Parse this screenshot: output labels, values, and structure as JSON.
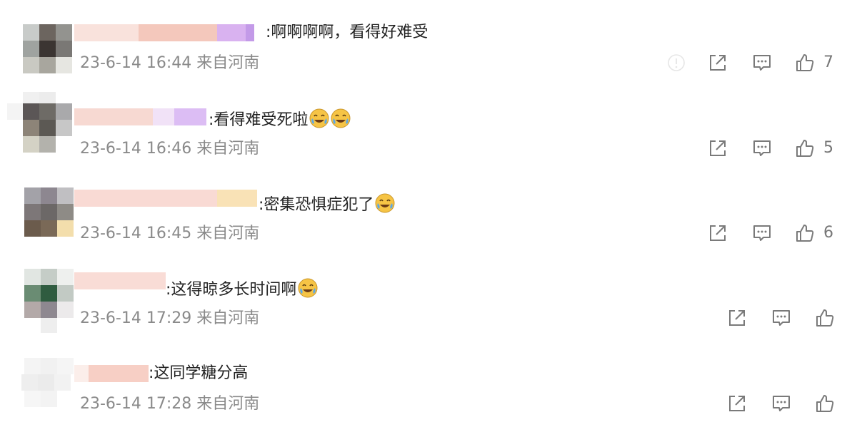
{
  "icons": {
    "share": "share-icon",
    "comment": "comment-icon",
    "like": "thumbs-up-icon",
    "report": "info-icon"
  },
  "colors": {
    "text": "#222222",
    "meta": "#8a8a8a",
    "icon": "#7a7a7a",
    "emoji_face": "#f6c445"
  },
  "comments": [
    {
      "text": ":啊啊啊啊，看得好难受",
      "timestamp": "23-6-14 16:44",
      "location": "来自河南",
      "likes": "7",
      "emoji_count": 0
    },
    {
      "text": ":看得难受死啦",
      "timestamp": "23-6-14 16:46",
      "location": "来自河南",
      "likes": "5",
      "emoji_count": 2
    },
    {
      "text": ":密集恐惧症犯了",
      "timestamp": "23-6-14 16:45",
      "location": "来自河南",
      "likes": "6",
      "emoji_count": 1
    },
    {
      "text": ":这得晾多长时间啊",
      "timestamp": "23-6-14 17:29",
      "location": "来自河南",
      "likes": "",
      "emoji_count": 1
    },
    {
      "text": ":这同学糖分高",
      "timestamp": "23-6-14 17:28",
      "location": "来自河南",
      "likes": "",
      "emoji_count": 0
    }
  ]
}
